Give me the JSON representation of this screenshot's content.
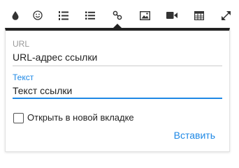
{
  "toolbar": {
    "icons": [
      "paragraph-color-icon",
      "emoticon-icon",
      "ordered-list-icon",
      "unordered-list-icon",
      "insert-link-icon",
      "insert-image-icon",
      "insert-video-icon",
      "insert-table-icon",
      "fullscreen-icon"
    ],
    "active": "insert-link-icon",
    "icon_color": "#333333"
  },
  "link_popup": {
    "url": {
      "label": "URL",
      "placeholder": "URL-адрес ссылки"
    },
    "text": {
      "label": "Текст",
      "placeholder": "Текст ссылки"
    },
    "open_new_tab_label": "Открыть в новой вкладке",
    "open_new_tab_checked": false,
    "insert_label": "Вставить",
    "accent_color": "#1e88e5"
  }
}
